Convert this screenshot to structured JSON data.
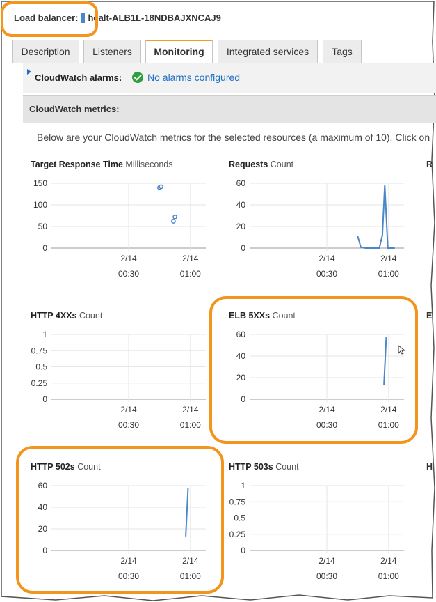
{
  "load_balancer": {
    "label": "Load balancer:",
    "name": "healt-ALB1L-18NDBAJXNCAJ9"
  },
  "tabs": [
    {
      "label": "Description",
      "active": false
    },
    {
      "label": "Listeners",
      "active": false
    },
    {
      "label": "Monitoring",
      "active": true
    },
    {
      "label": "Integrated services",
      "active": false
    },
    {
      "label": "Tags",
      "active": false
    }
  ],
  "alarms": {
    "label": "CloudWatch alarms:",
    "status_icon": "check-circle-icon",
    "link": "No alarms configured"
  },
  "metrics": {
    "header": "CloudWatch metrics:",
    "description": "Below are your CloudWatch metrics for the selected resources (a maximum of 10). Click on"
  },
  "highlight_color": "#f3951c",
  "line_color": "#4a86c8",
  "cut_labels": [
    "R",
    "E",
    "H"
  ],
  "chart_data": [
    {
      "type": "scatter",
      "title": "Target Response Time",
      "unit": "Milliseconds",
      "ylim": [
        0,
        150
      ],
      "y_ticks": [
        "150",
        "100",
        "50",
        "0"
      ],
      "xlim": [
        0,
        1
      ],
      "x_ticks": [
        {
          "date": "2/14",
          "time": "00:30",
          "at": 0.5
        },
        {
          "date": "2/14",
          "time": "01:00",
          "at": 0.9
        }
      ],
      "series": [
        {
          "points": [
            [
              0.7,
              140
            ],
            [
              0.71,
              142
            ],
            [
              0.79,
              62
            ],
            [
              0.8,
              72
            ]
          ]
        }
      ]
    },
    {
      "type": "line",
      "title": "Requests",
      "unit": "Count",
      "ylim": [
        0,
        60
      ],
      "y_ticks": [
        "60",
        "40",
        "20",
        "0"
      ],
      "xlim": [
        0,
        1
      ],
      "x_ticks": [
        {
          "date": "2/14",
          "time": "00:30",
          "at": 0.5
        },
        {
          "date": "2/14",
          "time": "01:00",
          "at": 0.9
        }
      ],
      "series": [
        {
          "points": [
            [
              0.7,
              11
            ],
            [
              0.72,
              1
            ],
            [
              0.75,
              0
            ],
            [
              0.84,
              0
            ],
            [
              0.86,
              12
            ],
            [
              0.875,
              58
            ],
            [
              0.895,
              0
            ],
            [
              0.94,
              0
            ]
          ]
        }
      ]
    },
    {
      "type": "line",
      "title": "HTTP 4XXs",
      "unit": "Count",
      "ylim": [
        0,
        1
      ],
      "y_ticks": [
        "1",
        "0.75",
        "0.5",
        "0.25",
        "0"
      ],
      "xlim": [
        0,
        1
      ],
      "x_ticks": [
        {
          "date": "2/14",
          "time": "00:30",
          "at": 0.5
        },
        {
          "date": "2/14",
          "time": "01:00",
          "at": 0.9
        }
      ],
      "series": [
        {
          "points": []
        }
      ]
    },
    {
      "type": "line",
      "title": "ELB 5XXs",
      "unit": "Count",
      "ylim": [
        0,
        60
      ],
      "y_ticks": [
        "60",
        "40",
        "20",
        "0"
      ],
      "xlim": [
        0,
        1
      ],
      "x_ticks": [
        {
          "date": "2/14",
          "time": "00:30",
          "at": 0.5
        },
        {
          "date": "2/14",
          "time": "01:00",
          "at": 0.9
        }
      ],
      "series": [
        {
          "points": [
            [
              0.87,
              13
            ],
            [
              0.885,
              58
            ]
          ]
        }
      ]
    },
    {
      "type": "line",
      "title": "HTTP 502s",
      "unit": "Count",
      "ylim": [
        0,
        60
      ],
      "y_ticks": [
        "60",
        "40",
        "20",
        "0"
      ],
      "xlim": [
        0,
        1
      ],
      "x_ticks": [
        {
          "date": "2/14",
          "time": "00:30",
          "at": 0.5
        },
        {
          "date": "2/14",
          "time": "01:00",
          "at": 0.9
        }
      ],
      "series": [
        {
          "points": [
            [
              0.87,
              13
            ],
            [
              0.885,
              58
            ]
          ]
        }
      ]
    },
    {
      "type": "line",
      "title": "HTTP 503s",
      "unit": "Count",
      "ylim": [
        0,
        1
      ],
      "y_ticks": [
        "1",
        "0.75",
        "0.5",
        "0.25",
        "0"
      ],
      "xlim": [
        0,
        1
      ],
      "x_ticks": [
        {
          "date": "2/14",
          "time": "00:30",
          "at": 0.5
        },
        {
          "date": "2/14",
          "time": "01:00",
          "at": 0.9
        }
      ],
      "series": [
        {
          "points": []
        }
      ]
    }
  ]
}
